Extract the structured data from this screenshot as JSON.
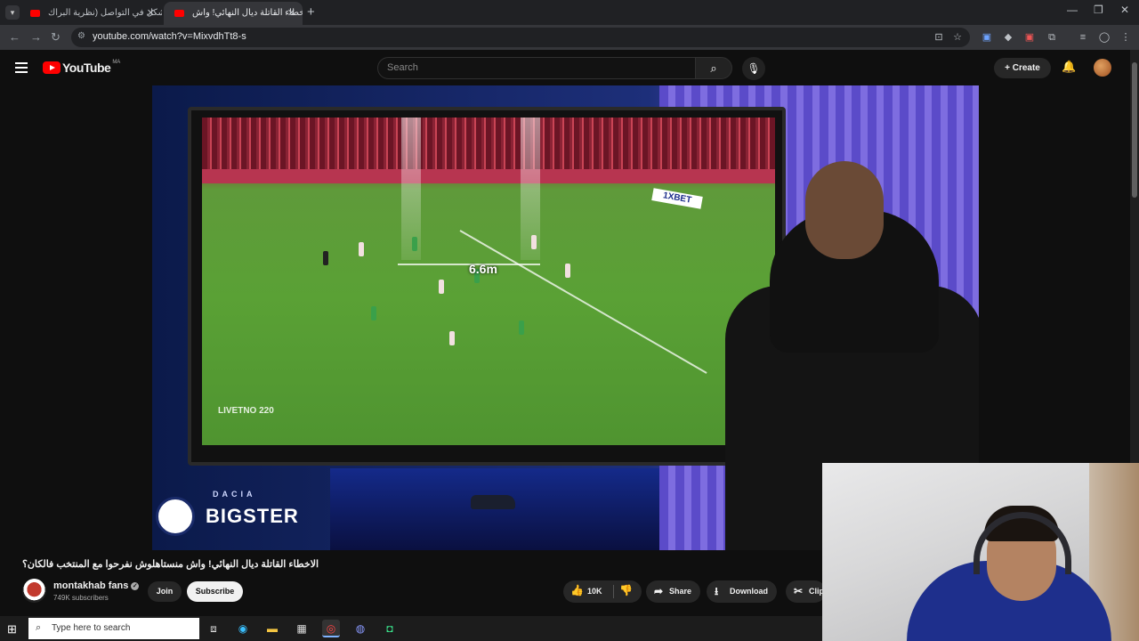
{
  "browser": {
    "tabs": [
      {
        "label": "مشكل في التواصل (نظرية البراك..."
      },
      {
        "label": "الاخطاء القاتلة ديال النهائي! واش..."
      }
    ],
    "new_tab_symbol": "+",
    "url": "youtube.com/watch?v=MixvdhTt8-s"
  },
  "youtube": {
    "logo_text": "YouTube",
    "country_code": "MA",
    "search_placeholder": "Search",
    "create_label": "Create"
  },
  "video": {
    "overlay_distance": "6.6m",
    "broadcaster_watermark": "LIVETNO 220",
    "sponsor_top": "DACIA",
    "sponsor_main": "BIGSTER",
    "board_ad": "1XBET"
  },
  "details": {
    "title": "الاخطاء القاتلة ديال النهائي! واش منستاهلوش نفرحوا مع المنتخب فالكان؟",
    "channel_name": "montakhab fans",
    "subscribers": "749K subscribers",
    "join_label": "Join",
    "subscribe_label": "Subscribe",
    "like_count": "10K",
    "share_label": "Share",
    "download_label": "Download",
    "clip_label": "Clip"
  },
  "taskbar": {
    "search_placeholder": "Type here to search"
  },
  "icons": {
    "menu": "hamburger-icon",
    "search": "magnifier",
    "mic": "microphone",
    "bell": "notification-bell",
    "like": "thumbs-up",
    "dislike": "thumbs-down",
    "share": "share-arrow",
    "download": "download-arrow",
    "clip": "scissors"
  }
}
